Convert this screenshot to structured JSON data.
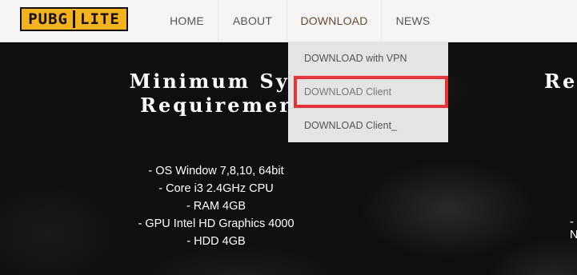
{
  "header": {
    "logo": {
      "left": "PUBG",
      "right": "LITE"
    },
    "nav": [
      "HOME",
      "ABOUT",
      "DOWNLOAD",
      "NEWS"
    ]
  },
  "dropdown": {
    "items": [
      "DOWNLOAD with VPN",
      "DOWNLOAD Client",
      "DOWNLOAD Client_"
    ]
  },
  "hero": {
    "min_heading_line1": "Minimum Sys",
    "min_heading_line2": "Requiremer",
    "rec_heading_fragment": "Re",
    "requirements": [
      "- OS Window 7,8,10, 64bit",
      "- Core i3 2.4GHz CPU",
      "- RAM 4GB",
      "- GPU Intel HD Graphics 4000",
      "- HDD 4GB"
    ],
    "right_fragment": "- N"
  },
  "colors": {
    "logo_bg": "#f5b21a",
    "highlight": "#e8333a",
    "header_bg": "#f5f5f5",
    "dropdown_bg": "#e4e4e4"
  }
}
